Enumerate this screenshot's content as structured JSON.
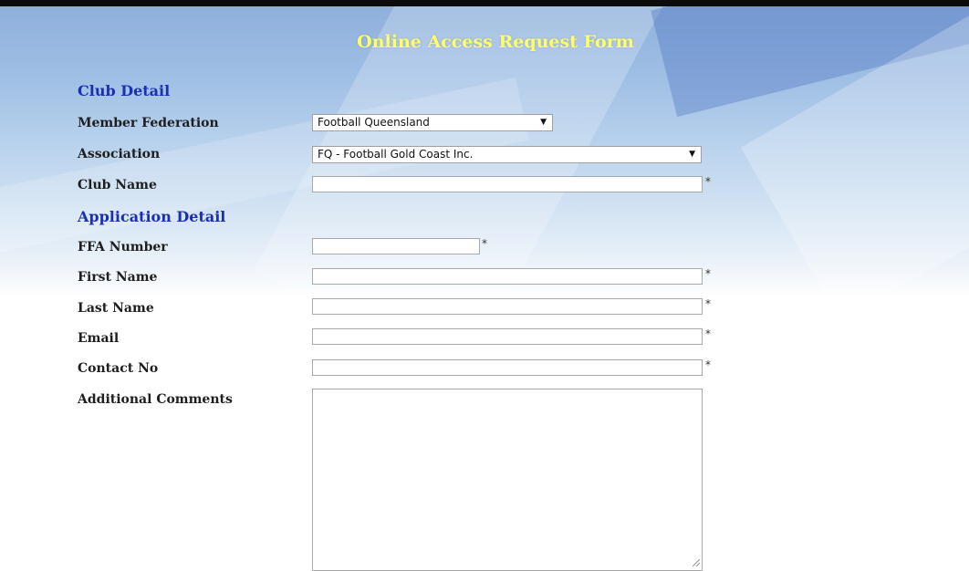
{
  "form": {
    "title": "Online Access Request Form",
    "required_marker": "*"
  },
  "club_detail": {
    "heading": "Club Detail",
    "member_federation": {
      "label": "Member Federation",
      "selected": "Football Queensland"
    },
    "association": {
      "label": "Association",
      "selected": "FQ - Football Gold Coast Inc."
    },
    "club_name": {
      "label": "Club Name",
      "value": ""
    }
  },
  "application_detail": {
    "heading": "Application Detail",
    "ffa_number": {
      "label": "FFA Number",
      "value": ""
    },
    "first_name": {
      "label": "First Name",
      "value": ""
    },
    "last_name": {
      "label": "Last Name",
      "value": ""
    },
    "email": {
      "label": "Email",
      "value": ""
    },
    "contact_no": {
      "label": "Contact No",
      "value": ""
    },
    "additional_comments": {
      "label": "Additional Comments",
      "value": ""
    }
  },
  "colors": {
    "title": "#ffff66",
    "section_heading": "#1b2fb3"
  }
}
